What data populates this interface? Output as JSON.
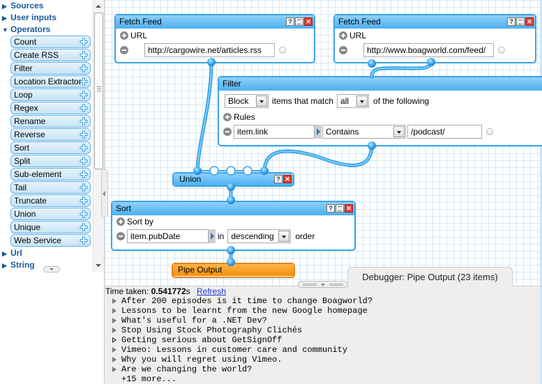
{
  "sidebar": {
    "categories_top": [
      {
        "label": "Sources",
        "expanded": false
      },
      {
        "label": "User inputs",
        "expanded": false
      },
      {
        "label": "Operators",
        "expanded": true
      }
    ],
    "operators": [
      "Count",
      "Create RSS",
      "Filter",
      "Location Extractor",
      "Loop",
      "Regex",
      "Rename",
      "Reverse",
      "Sort",
      "Split",
      "Sub-element",
      "Tail",
      "Truncate",
      "Union",
      "Unique",
      "Web Service"
    ],
    "categories_bottom": [
      {
        "label": "Url",
        "expanded": false
      },
      {
        "label": "String",
        "expanded": false
      }
    ]
  },
  "modules": {
    "fetch1": {
      "title": "Fetch Feed",
      "url_label": "URL",
      "url_value": "http://cargowire.net/articles.rss"
    },
    "fetch2": {
      "title": "Fetch Feed",
      "url_label": "URL",
      "url_value": "http://www.boagworld.com/feed/"
    },
    "filter": {
      "title": "Filter",
      "mode": "Block",
      "text_items_that_match": "items that match",
      "match": "all",
      "text_of_following": "of the following",
      "rules_label": "Rules",
      "rule_field": "item.link",
      "rule_op": "Contains",
      "rule_value": "/podcast/"
    },
    "union": {
      "title": "Union"
    },
    "sort": {
      "title": "Sort",
      "sort_by_label": "Sort by",
      "field": "item.pubDate",
      "text_in": "in",
      "direction": "descending",
      "text_order": "order"
    },
    "output": {
      "title": "Pipe Output"
    }
  },
  "debugger": {
    "tab_label": "Debugger: Pipe Output (23 items)",
    "time_label": "Time taken:",
    "time_value": "0.541772",
    "time_unit": "s",
    "refresh_label": "Refresh",
    "items": [
      {
        "title": "After 200 episodes is it time to change Boagworld?",
        "style": "filled"
      },
      {
        "title": "Lessons to be learnt from the new Google homepage",
        "style": "filled"
      },
      {
        "title": "What's useful for a .NET Dev?",
        "style": "filled"
      },
      {
        "title": "Stop Using Stock Photography Clichés",
        "style": "filled"
      },
      {
        "title": "Getting serious about GetSignOff",
        "style": "hollow"
      },
      {
        "title": "Vimeo: Lessons in customer care and community",
        "style": "filled"
      },
      {
        "title": "Why you will regret using Vimeo.",
        "style": "filled"
      },
      {
        "title": "Are we changing the world?",
        "style": "filled"
      }
    ],
    "more_label": "+15 more..."
  },
  "icons": {
    "help": "?",
    "close": "✕"
  },
  "colors": {
    "module_border": "#3aa3ea",
    "module_header": "#4cb0f0",
    "wire": "#4ab8f2",
    "output_header": "#f39010",
    "link": "#1a36c8",
    "category_text": "#1a5a9a"
  }
}
